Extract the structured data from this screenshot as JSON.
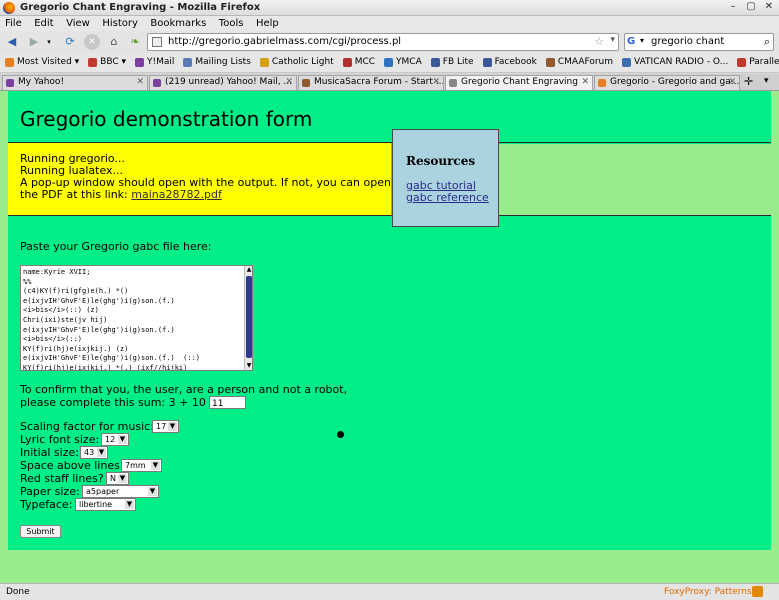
{
  "window": {
    "title": "Gregorio Chant Engraving - Mozilla Firefox",
    "controls": [
      "–",
      "▢",
      "✕"
    ]
  },
  "menu": [
    "File",
    "Edit",
    "View",
    "History",
    "Bookmarks",
    "Tools",
    "Help"
  ],
  "nav": {
    "url": "http://gregorio.gabrielmass.com/cgi/process.pl",
    "search_query": "gregorio chant"
  },
  "bookmarks": [
    {
      "label": "Most Visited ▾",
      "color": "#e67e22"
    },
    {
      "label": "BBC ▾",
      "color": "#c0392b"
    },
    {
      "label": "Y!Mail",
      "color": "#7b3fa0"
    },
    {
      "label": "Mailing Lists",
      "color": "#5b7bb8"
    },
    {
      "label": "Catholic Light",
      "color": "#d4a017"
    },
    {
      "label": "MCC",
      "color": "#b03030"
    },
    {
      "label": "YMCA",
      "color": "#3070c0"
    },
    {
      "label": "FB Lite",
      "color": "#3b5998"
    },
    {
      "label": "Facebook",
      "color": "#3b5998"
    },
    {
      "label": "CMAAForum",
      "color": "#8e5b2e"
    },
    {
      "label": "VATICAN RADIO - O...",
      "color": "#3f6fb0"
    },
    {
      "label": "Parallels Power Pa...",
      "color": "#c0392b"
    }
  ],
  "tabs": [
    {
      "label": "My Yahoo!",
      "color": "#7b3fa0",
      "active": false
    },
    {
      "label": "(219 unread) Yahoo! Mail, ...",
      "color": "#7b3fa0",
      "active": false
    },
    {
      "label": "MusicaSacra Forum - Start ...",
      "color": "#8e5b2e",
      "active": false
    },
    {
      "label": "Gregorio Chant Engraving",
      "color": "#888888",
      "active": true
    },
    {
      "label": "Gregorio - Gregorio and ga...",
      "color": "#e67e22",
      "active": false
    }
  ],
  "page": {
    "heading": "Gregorio demonstration form",
    "status_lines": [
      "Running gregorio...",
      "Running lualatex...",
      "A pop-up window should open with the output. If not, you can open the PDF at this link: "
    ],
    "pdf_link": "maina28782.pdf",
    "resources": {
      "title": "Resources",
      "links": [
        "gabc tutorial",
        "gabc reference"
      ]
    },
    "paste_label": "Paste your Gregorio gabc file here:",
    "gabc_text": "name:Kyrie XVII;\n%%\n(c4)KY(f)ri(gfg)e(h.) *()\ne(ixjvIH'GhvF'E)le(ghg')i(g)son.(f.)\n<i>bis</i>(::) (z)\nChri(ixi)ste(jv hij)\ne(ixjvIH'GhvF'E)le(ghg')i(g)son.(f.)\n<i>bis</i>(::)\nKY(f)ri(hj)e(ixjkij.) (z)\ne(ixjvIH'GhvF'E)le(ghg')i(g)son.(f.)  (::)\nKY(f)ri(hj)e(ixjkij.) *(,) (ixf//hijki)",
    "captcha_label_1": "To confirm that you, the user, are a person and not a robot,",
    "captcha_label_2": "please complete this sum: 3 + 10 = ",
    "captcha_answer": "11",
    "fields": [
      {
        "label": "Scaling factor for music:",
        "value": "17"
      },
      {
        "label": "Lyric font size:",
        "value": "12"
      },
      {
        "label": "Initial size:",
        "value": "43"
      },
      {
        "label": "Space above lines:",
        "value": "7mm"
      },
      {
        "label": "Red staff lines?",
        "value": "N"
      },
      {
        "label": "Paper size:",
        "value": "a5paper"
      },
      {
        "label": "Typeface:",
        "value": "libertine"
      }
    ],
    "submit_label": "Submit"
  },
  "status": {
    "text": "Done",
    "foxyproxy": "FoxyProxy: Patterns"
  },
  "colors": {
    "page_bg": "#00ee88",
    "outer_bg": "#98ec8c",
    "status_box": "#ffff00",
    "resources_box": "#abd3df"
  }
}
